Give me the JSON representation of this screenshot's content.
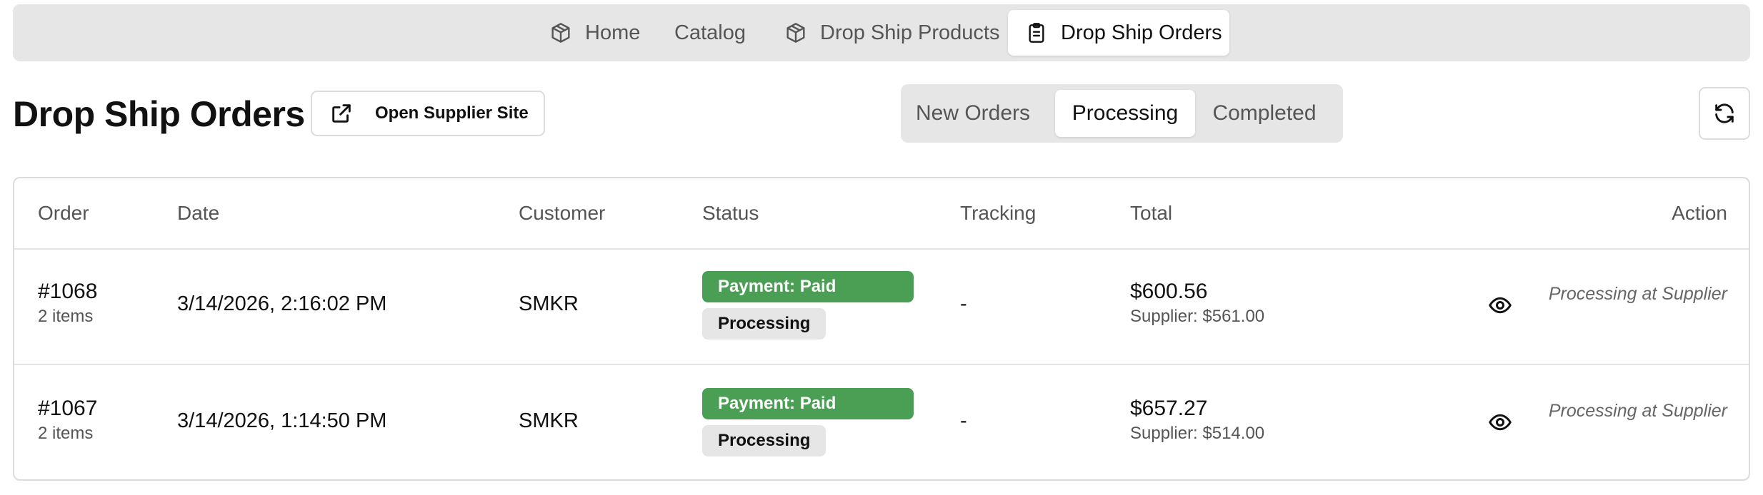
{
  "nav": {
    "tabs": [
      {
        "label": "Home",
        "icon": "box-icon"
      },
      {
        "label": "Catalog",
        "icon": ""
      },
      {
        "label": "Drop Ship Products",
        "icon": "box-icon"
      },
      {
        "label": "Drop Ship Orders",
        "icon": "clipboard-icon",
        "active": true
      }
    ]
  },
  "header": {
    "title": "Drop Ship Orders",
    "supplier_button": "Open Supplier Site",
    "refresh_icon": "refresh-icon"
  },
  "filters": {
    "tabs": [
      {
        "label": "New Orders"
      },
      {
        "label": "Processing",
        "active": true
      },
      {
        "label": "Completed"
      }
    ]
  },
  "table": {
    "columns": [
      "Order",
      "Date",
      "Customer",
      "Status",
      "Tracking",
      "Total",
      "Action"
    ],
    "rows": [
      {
        "order": "#1068",
        "items": "2 items",
        "date": "3/14/2026, 2:16:02 PM",
        "customer": "SMKR",
        "payment_badge": "Payment: Paid",
        "status_badge": "Processing",
        "tracking": "-",
        "total": "$600.56",
        "supplier": "Supplier: $561.00",
        "action": "Processing at Supplier"
      },
      {
        "order": "#1067",
        "items": "2 items",
        "date": "3/14/2026, 1:14:50 PM",
        "customer": "SMKR",
        "payment_badge": "Payment: Paid",
        "status_badge": "Processing",
        "tracking": "-",
        "total": "$657.27",
        "supplier": "Supplier: $514.00",
        "action": "Processing at Supplier"
      }
    ]
  },
  "colors": {
    "nav_bg": "#e6e6e6",
    "paid_badge": "#4a9f55",
    "border": "#dcdcdc"
  }
}
